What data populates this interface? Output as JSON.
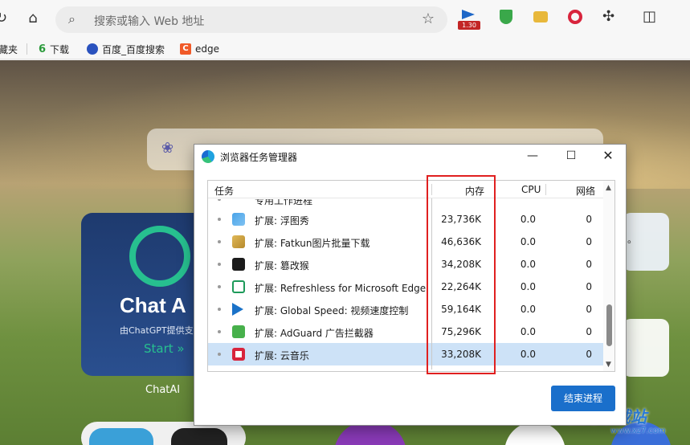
{
  "browser": {
    "address_placeholder": "搜索或输入 Web 地址",
    "extensions": [
      {
        "name": "global-speed",
        "badge": "1.30"
      },
      {
        "name": "adguard"
      },
      {
        "name": "fatkun"
      },
      {
        "name": "cloud-music"
      }
    ],
    "favorites": [
      {
        "label": "藏夹"
      },
      {
        "icon_text": "6",
        "label": "下载"
      },
      {
        "label": "百度_百度搜索"
      },
      {
        "icon_text": "C",
        "label": "edge"
      }
    ]
  },
  "new_tab": {
    "chat_tile": {
      "title": "Chat A",
      "desc": "由ChatGPT提供支",
      "start": "Start »",
      "caption": "ChatAI"
    },
    "right_tile_text": "。"
  },
  "watermark": {
    "text": "极光下载站",
    "url": "www.xz7.com"
  },
  "task_manager": {
    "title": "浏览器任务管理器",
    "columns": {
      "task": "任务",
      "memory": "内存",
      "cpu": "CPU",
      "network": "网络"
    },
    "partial_row": "专用工作进程",
    "rows": [
      {
        "icon": "image-icon",
        "name": "扩展: 浮图秀",
        "memory": "23,736K",
        "cpu": "0.0",
        "network": "0",
        "selected": false
      },
      {
        "icon": "fatkun-icon",
        "name": "扩展: Fatkun图片批量下载",
        "memory": "46,636K",
        "cpu": "0.0",
        "network": "0",
        "selected": false
      },
      {
        "icon": "monkey-icon",
        "name": "扩展: 篡改猴",
        "memory": "34,208K",
        "cpu": "0.0",
        "network": "0",
        "selected": false
      },
      {
        "icon": "refresh-icon",
        "name": "扩展: Refreshless for Microsoft Edge",
        "memory": "22,264K",
        "cpu": "0.0",
        "network": "0",
        "selected": false
      },
      {
        "icon": "play-icon",
        "name": "扩展: Global Speed: 视频速度控制",
        "memory": "59,164K",
        "cpu": "0.0",
        "network": "0",
        "selected": false
      },
      {
        "icon": "shield-icon",
        "name": "扩展: AdGuard 广告拦截器",
        "memory": "75,296K",
        "cpu": "0.0",
        "network": "0",
        "selected": false
      },
      {
        "icon": "music-icon",
        "name": "扩展: 云音乐",
        "memory": "33,208K",
        "cpu": "0.0",
        "network": "0",
        "selected": true
      }
    ],
    "end_button": "结束进程"
  }
}
